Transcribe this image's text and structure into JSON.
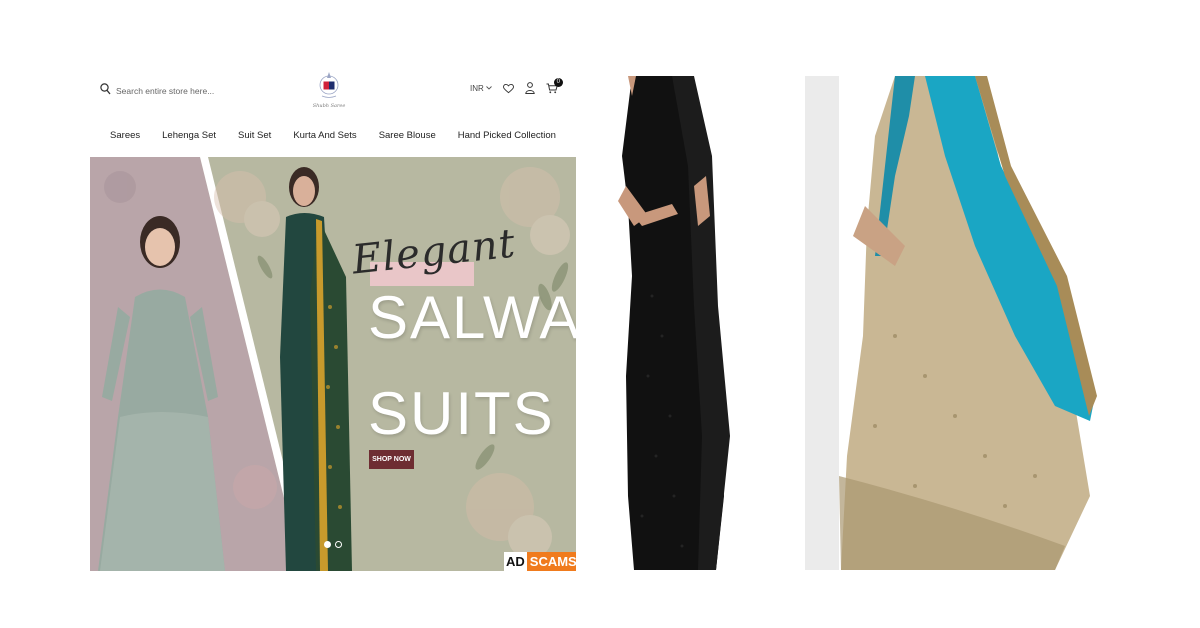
{
  "header": {
    "search_placeholder": "Search entire store here...",
    "logo_caption": "Shubh Saree",
    "currency": "INR",
    "cart_count": "0",
    "icons": [
      "search-icon",
      "logo-emblem-icon",
      "chevron-down-icon",
      "heart-icon",
      "user-icon",
      "cart-icon"
    ]
  },
  "nav": {
    "items": [
      {
        "label": "Sarees"
      },
      {
        "label": "Lehenga Set"
      },
      {
        "label": "Suit Set"
      },
      {
        "label": "Kurta And Sets"
      },
      {
        "label": "Saree Blouse"
      },
      {
        "label": "Hand Picked Collection"
      }
    ]
  },
  "banner": {
    "script_word": "Elegant",
    "headline_1": "SALWAAR",
    "headline_2": "SUITS",
    "cta_label": "SHOP NOW",
    "slides_total": 2,
    "active_slide": 1
  },
  "watermark": {
    "part_1": "AD",
    "part_2": "SCAMS"
  },
  "colors": {
    "cta": "#6e2d32",
    "watermark_orange": "#f07b1d",
    "banner_green": "#b7b8a1",
    "banner_mauve": "#b9a5a9"
  }
}
